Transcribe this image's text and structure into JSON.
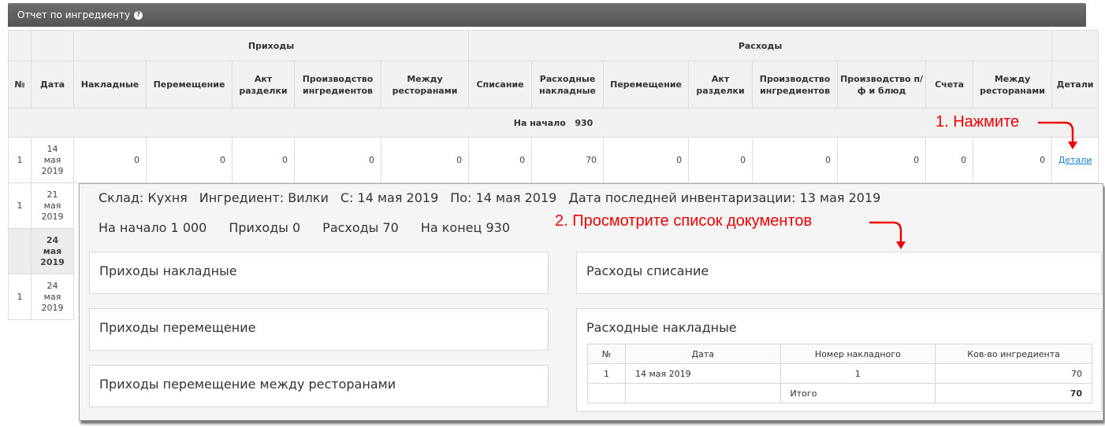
{
  "window": {
    "title": "Отчет по ингредиенту",
    "help_icon": "?"
  },
  "table": {
    "group_headers": {
      "incoming": "Приходы",
      "outgoing": "Расходы"
    },
    "columns": [
      "№",
      "Дата",
      "Накладные",
      "Перемещение",
      "Акт разделки",
      "Производство ингредиентов",
      "Между ресторанами",
      "Списание",
      "Расходные накладные",
      "Перемещение",
      "Акт разделки",
      "Производство ингредиентов",
      "Производство п/ф и блюд",
      "Счета",
      "Между ресторанами",
      "Детали"
    ],
    "start_label": "На начало",
    "start_value": "930",
    "rows": [
      {
        "num": "1",
        "date": [
          "14",
          "мая",
          "2019"
        ],
        "values": [
          "0",
          "0",
          "0",
          "0",
          "0",
          "0",
          "70",
          "0",
          "0",
          "0",
          "0",
          "0",
          "0"
        ],
        "details": "Детали"
      },
      {
        "num": "1",
        "date": [
          "21",
          "мая",
          "2019"
        ]
      },
      {
        "num": "",
        "date": [
          "24",
          "мая",
          "2019"
        ]
      },
      {
        "num": "1",
        "date": [
          "24",
          "мая",
          "2019"
        ]
      }
    ]
  },
  "annotations": {
    "step1": "1. Нажмите",
    "step2": "2. Просмотрите список документов"
  },
  "popup": {
    "info": [
      "Склад: Кухня",
      "Ингредиент: Вилки",
      "С: 14 мая 2019",
      "По: 14 мая 2019",
      "Дата последней инвентаризации: 13 мая 2019"
    ],
    "summary": [
      "На начало 1 000",
      "Приходы 0",
      "Расходы 70",
      "На конец 930"
    ],
    "sections": {
      "in_invoices": "Приходы накладные",
      "in_transfer": "Приходы перемещение",
      "in_between": "Приходы перемещение между ресторанами",
      "out_writeoff": "Расходы списание",
      "out_invoices": "Расходные накладные"
    },
    "invoice_table": {
      "headers": [
        "№",
        "Дата",
        "Номер накладного",
        "Ков-во ингредиента"
      ],
      "rows": [
        {
          "num": "1",
          "date": "14 мая 2019",
          "number": "1",
          "qty": "70"
        }
      ],
      "total_label": "Итого",
      "total_value": "70"
    }
  },
  "colors": {
    "accent_red": "#e00000",
    "link": "#1a7fd1"
  }
}
